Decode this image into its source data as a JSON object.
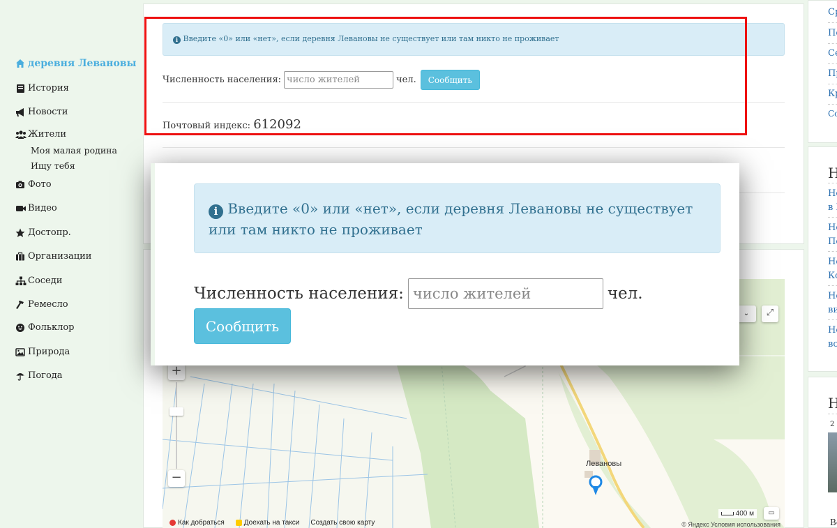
{
  "sidebar": {
    "items": [
      {
        "label": "деревня Левановы",
        "icon": "home-icon"
      },
      {
        "label": "История",
        "icon": "book-icon"
      },
      {
        "label": "Новости",
        "icon": "bullhorn-icon"
      },
      {
        "label": "Жители",
        "icon": "users-icon"
      },
      {
        "label": "Фото",
        "icon": "camera-icon"
      },
      {
        "label": "Видео",
        "icon": "video-icon"
      },
      {
        "label": "Достопр.",
        "icon": "star-icon"
      },
      {
        "label": "Организации",
        "icon": "briefcase-icon"
      },
      {
        "label": "Соседи",
        "icon": "sitemap-icon"
      },
      {
        "label": "Ремесло",
        "icon": "hammer-icon"
      },
      {
        "label": "Фольклор",
        "icon": "grin-icon"
      },
      {
        "label": "Природа",
        "icon": "image-icon"
      },
      {
        "label": "Погода",
        "icon": "umbrella-icon"
      }
    ],
    "subitems": [
      "Моя малая родина",
      "Ищу тебя"
    ]
  },
  "population_form": {
    "alert_text": "Введите «0» или «нет», если деревня Левановы не существует или там никто не проживает",
    "label": "Численность населения:",
    "placeholder": "число жителей",
    "unit": "чел.",
    "submit_label": "Сообщить"
  },
  "postal": {
    "label": "Почтовый индекс:",
    "value": "612092"
  },
  "map": {
    "village_label": "Левановы",
    "footer_links": [
      "Как добраться",
      "Доехать на такси",
      "Создать свою карту"
    ],
    "scale_label": "400 м",
    "copyright": "© Яндекс Условия использования"
  },
  "right_column": {
    "links_top": [
      "Ср",
      "Пе",
      "Се",
      "Пр",
      "Кр",
      "Сс"
    ],
    "heading_1": "Н",
    "news": [
      "Не",
      "в Е",
      "Не",
      "Пе",
      "Не",
      "Ко",
      "Не",
      "ви",
      "Не",
      "вс"
    ],
    "heading_2": "Н",
    "snippet": "2",
    "bottom": "Вс"
  },
  "colors": {
    "accent": "#4aaede",
    "alert_bg": "#d9edf7",
    "alert_text": "#31708f",
    "button": "#5bc0de",
    "highlight": "#ee1111",
    "page_bg": "#edf6ec"
  }
}
